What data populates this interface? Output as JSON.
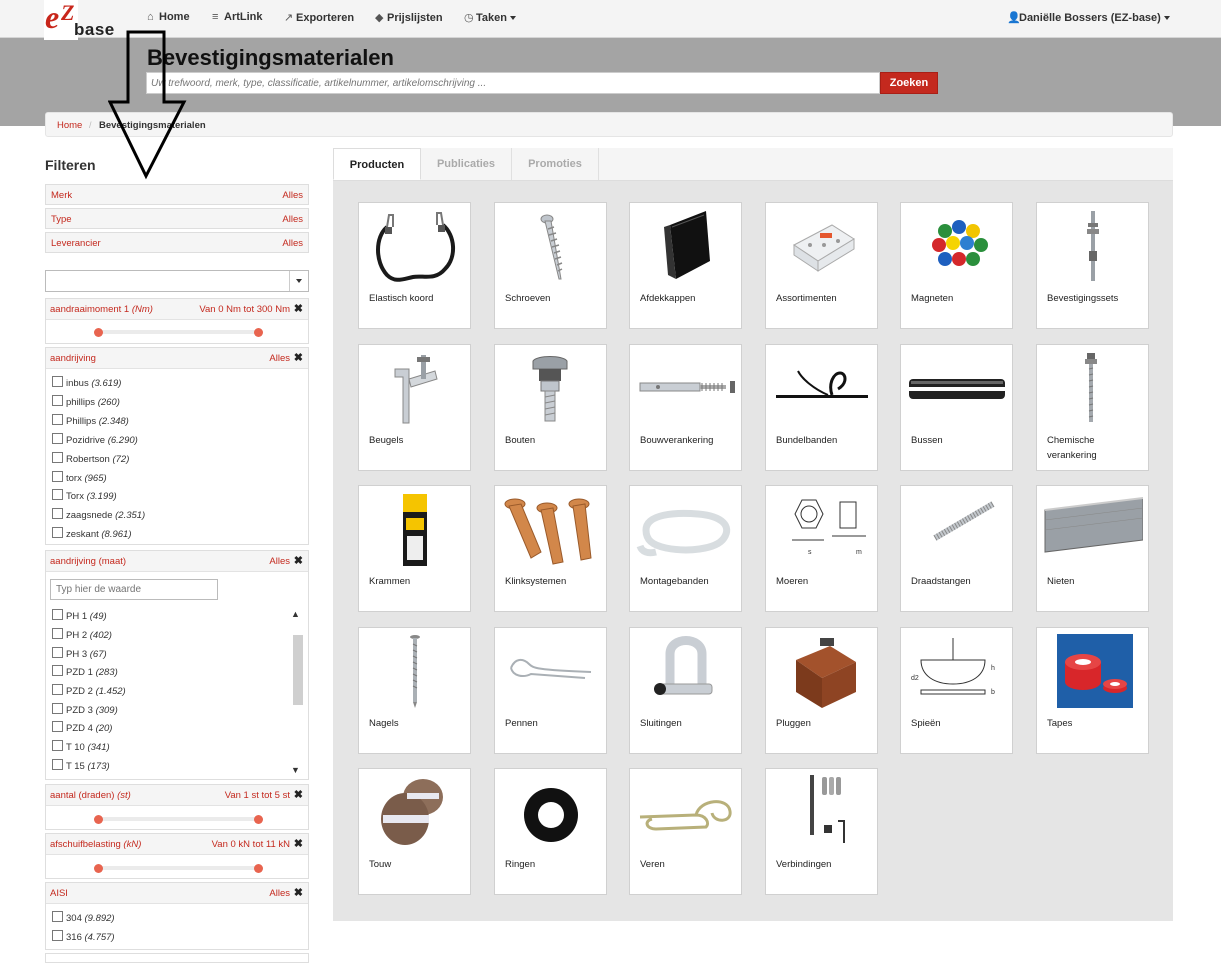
{
  "app": {
    "logo_text": "base",
    "logo_mark": "eZ",
    "nav": {
      "home": "Home",
      "artlink": "ArtLink",
      "exporteren": "Exporteren",
      "prijslijsten": "Prijslijsten",
      "taken": "Taken",
      "user": "Daniëlle Bossers (EZ-base)"
    }
  },
  "header": {
    "title": "Bevestigingsmaterialen",
    "search_placeholder": "Uw trefwoord, merk, type, classificatie, artikelnummer, artikelomschrijving ...",
    "search_button": "Zoeken"
  },
  "breadcrumb": {
    "home": "Home",
    "separator": "/",
    "current": "Bevestigingsmaterialen"
  },
  "filters": {
    "title": "Filteren",
    "facets": [
      {
        "label": "Merk",
        "value": "Alles"
      },
      {
        "label": "Type",
        "value": "Alles"
      },
      {
        "label": "Leverancier",
        "value": "Alles"
      }
    ],
    "aandraaimoment": {
      "label": "aandraaimoment 1",
      "unit": "(Nm)",
      "range": "Van 0 Nm tot 300 Nm",
      "min": 0,
      "max": 300
    },
    "aandrijving": {
      "label": "aandrijving",
      "value": "Alles",
      "options": [
        {
          "name": "inbus",
          "count": "(3.619)"
        },
        {
          "name": "phillips",
          "count": "(260)"
        },
        {
          "name": "Phillips",
          "count": "(2.348)"
        },
        {
          "name": "Pozidrive",
          "count": "(6.290)"
        },
        {
          "name": "Robertson",
          "count": "(72)"
        },
        {
          "name": "torx",
          "count": "(965)"
        },
        {
          "name": "Torx",
          "count": "(3.199)"
        },
        {
          "name": "zaagsnede",
          "count": "(2.351)"
        },
        {
          "name": "zeskant",
          "count": "(8.961)"
        }
      ]
    },
    "aandrijving_maat": {
      "label": "aandrijving (maat)",
      "value": "Alles",
      "input_placeholder": "Typ hier de waarde",
      "options": [
        {
          "name": "PH 1",
          "count": "(49)"
        },
        {
          "name": "PH 2",
          "count": "(402)"
        },
        {
          "name": "PH 3",
          "count": "(67)"
        },
        {
          "name": "PZD 1",
          "count": "(283)"
        },
        {
          "name": "PZD 2",
          "count": "(1.452)"
        },
        {
          "name": "PZD 3",
          "count": "(309)"
        },
        {
          "name": "PZD 4",
          "count": "(20)"
        },
        {
          "name": "T 10",
          "count": "(341)"
        },
        {
          "name": "T 15",
          "count": "(173)"
        }
      ]
    },
    "aantal_draden": {
      "label": "aantal (draden)",
      "unit": "(st)",
      "range": "Van 1 st tot 5 st",
      "min": 1,
      "max": 5
    },
    "afschuifbelasting": {
      "label": "afschuifbelasting",
      "unit": "(kN)",
      "range": "Van 0 kN tot 11 kN",
      "min": 0,
      "max": 11
    },
    "aisi": {
      "label": "AISI",
      "value": "Alles",
      "options": [
        {
          "name": "304",
          "count": "(9.892)"
        },
        {
          "name": "316",
          "count": "(4.757)"
        }
      ]
    }
  },
  "tabs": [
    "Producten",
    "Publicaties",
    "Promoties"
  ],
  "products": [
    {
      "label": "Elastisch koord",
      "icon": "elastic-cord"
    },
    {
      "label": "Schroeven",
      "icon": "screw"
    },
    {
      "label": "Afdekkappen",
      "icon": "cap"
    },
    {
      "label": "Assortimenten",
      "icon": "assortment-box"
    },
    {
      "label": "Magneten",
      "icon": "magnets"
    },
    {
      "label": "Bevestigingssets",
      "icon": "fixing-set"
    },
    {
      "label": "Beugels",
      "icon": "bracket"
    },
    {
      "label": "Bouten",
      "icon": "bolt"
    },
    {
      "label": "Bouwverankering",
      "icon": "anchor"
    },
    {
      "label": "Bundelbanden",
      "icon": "cable-tie"
    },
    {
      "label": "Bussen",
      "icon": "bushing"
    },
    {
      "label": "Chemische verankering",
      "icon": "chemical-anchor"
    },
    {
      "label": "Krammen",
      "icon": "staples-pack"
    },
    {
      "label": "Klinksystemen",
      "icon": "rivets"
    },
    {
      "label": "Montagebanden",
      "icon": "mounting-tape"
    },
    {
      "label": "Moeren",
      "icon": "nut-drawing"
    },
    {
      "label": "Draadstangen",
      "icon": "threaded-rod"
    },
    {
      "label": "Nieten",
      "icon": "staple-strip"
    },
    {
      "label": "Nagels",
      "icon": "nail"
    },
    {
      "label": "Pennen",
      "icon": "pin"
    },
    {
      "label": "Sluitingen",
      "icon": "shackle"
    },
    {
      "label": "Pluggen",
      "icon": "plug-case"
    },
    {
      "label": "Spieën",
      "icon": "key-drawing"
    },
    {
      "label": "Tapes",
      "icon": "tape"
    },
    {
      "label": "Touw",
      "icon": "rope"
    },
    {
      "label": "Ringen",
      "icon": "washer"
    },
    {
      "label": "Veren",
      "icon": "spring-clip"
    },
    {
      "label": "Verbindingen",
      "icon": "dowels"
    }
  ]
}
